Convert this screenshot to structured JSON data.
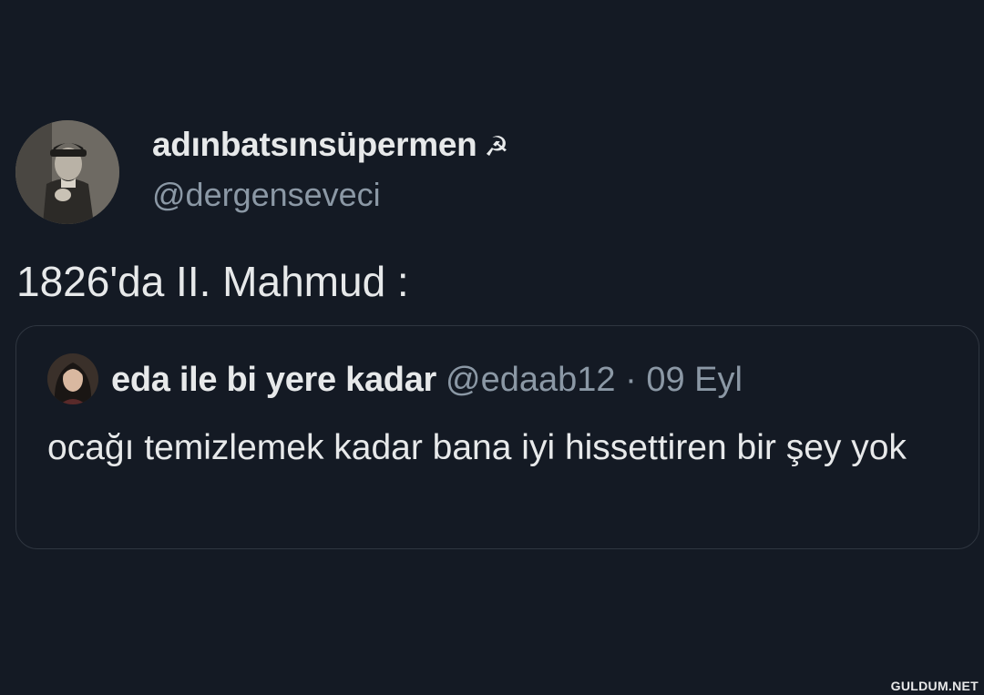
{
  "tweet": {
    "display_name": "adınbatsınsüpermen",
    "name_emoji": "☭",
    "handle": "@dergenseveci",
    "text": "1826'da II. Mahmud :"
  },
  "quoted_tweet": {
    "display_name": "eda ile bi yere kadar",
    "meta": "@edaab12 · 09 Eyl",
    "text": "ocağı temizlemek kadar bana iyi hissettiren bir şey yok"
  },
  "watermark": "GULDUM.NET",
  "colors": {
    "background": "#141a24",
    "primary_text": "#e7e9ea",
    "secondary_text": "#8b98a5",
    "border": "#2f3640"
  }
}
